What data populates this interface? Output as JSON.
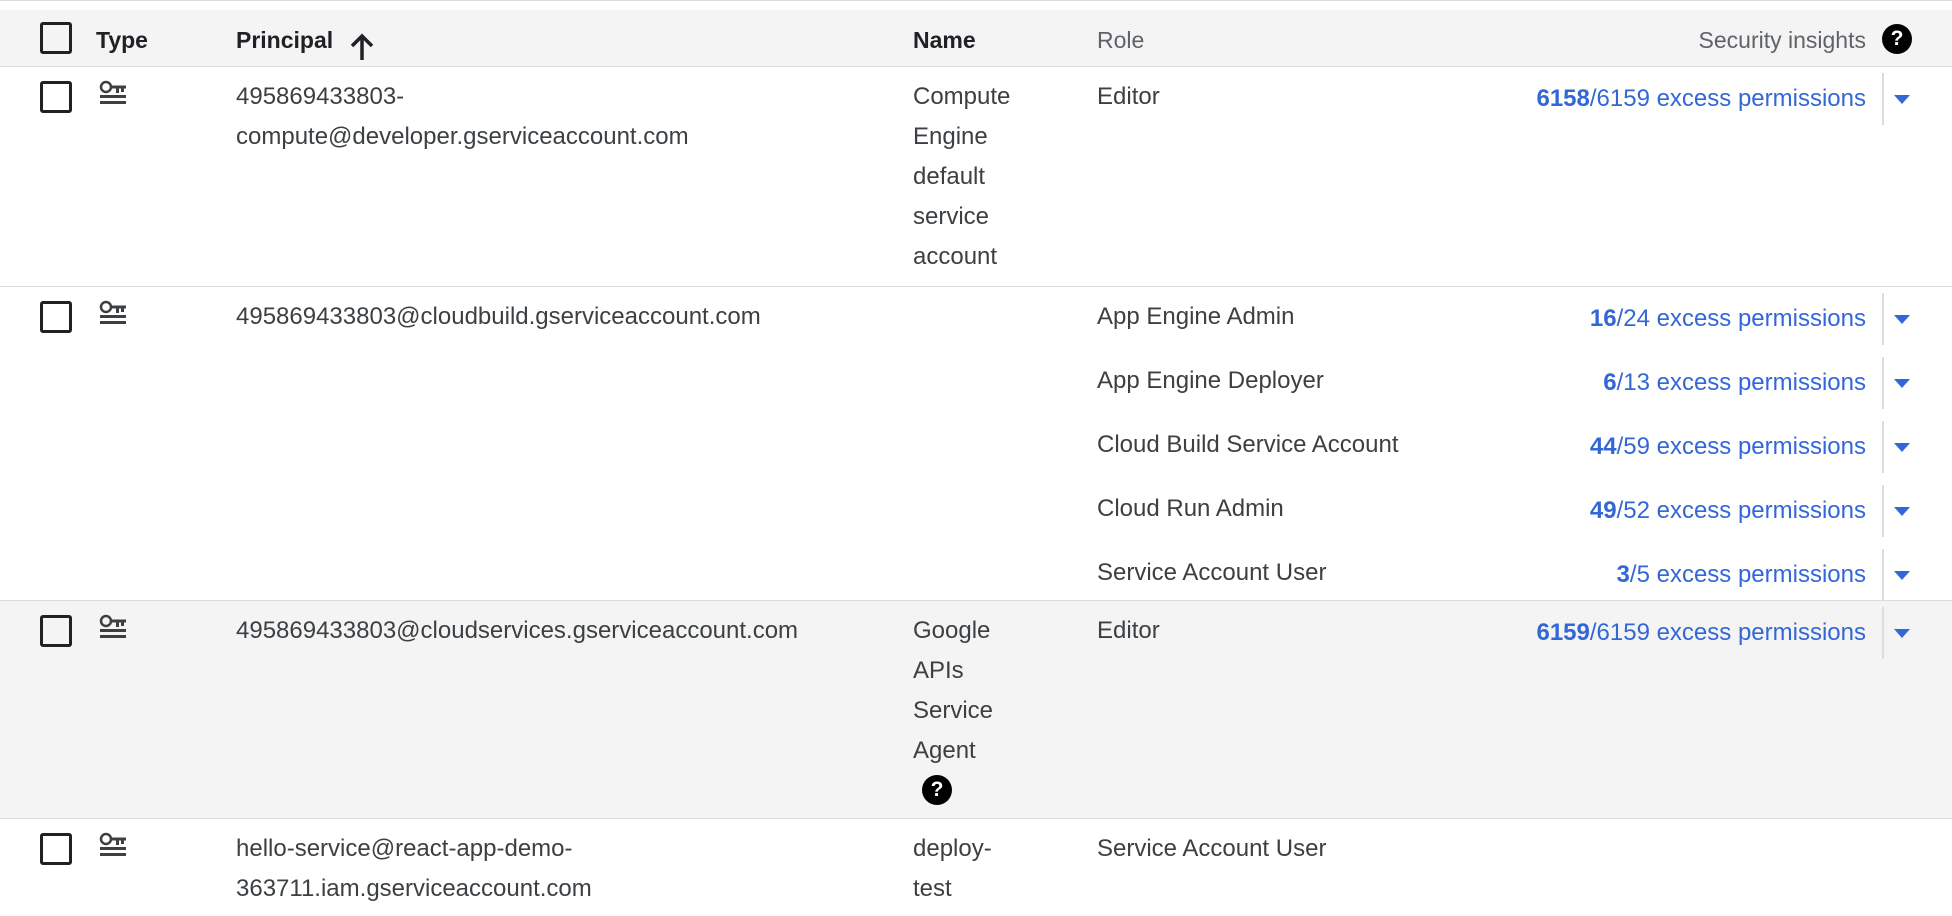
{
  "header": {
    "type": "Type",
    "principal": "Principal",
    "name": "Name",
    "role": "Role",
    "security_insights": "Security insights",
    "help_glyph": "?"
  },
  "rows": [
    {
      "principal": "495869433803-\ncompute@developer.gserviceaccount.com",
      "name": "Compute\nEngine\ndefault\nservice\naccount",
      "roles": [
        {
          "role": "Editor",
          "excess": "6158",
          "total": "/6159 excess permissions"
        }
      ]
    },
    {
      "principal": "495869433803@cloudbuild.gserviceaccount.com",
      "name": "",
      "roles": [
        {
          "role": "App Engine Admin",
          "excess": "16",
          "total": "/24 excess permissions"
        },
        {
          "role": "App Engine Deployer",
          "excess": "6",
          "total": "/13 excess permissions"
        },
        {
          "role": "Cloud Build Service Account",
          "excess": "44",
          "total": "/59 excess permissions"
        },
        {
          "role": "Cloud Run Admin",
          "excess": "49",
          "total": "/52 excess permissions"
        },
        {
          "role": "Service Account User",
          "excess": "3",
          "total": "/5 excess permissions"
        }
      ]
    },
    {
      "principal": "495869433803@cloudservices.gserviceaccount.com",
      "name": "Google\nAPIs\nService\nAgent",
      "name_help": "?",
      "roles": [
        {
          "role": "Editor",
          "excess": "6159",
          "total": "/6159 excess permissions"
        }
      ]
    },
    {
      "principal": "hello-service@react-app-demo-\n363711.iam.gserviceaccount.com",
      "name": "deploy-\ntest",
      "roles": [
        {
          "role": "Service Account User"
        }
      ]
    }
  ],
  "colors": {
    "link": "#3367d6",
    "header_bg": "#f4f4f4",
    "alt_row_bg": "#f4f4f4",
    "text": "#3c4043",
    "divider": "#dadce0"
  },
  "icons": {
    "type": "service-account-key-icon",
    "sort": "arrow-up-icon",
    "help": "help-circle-icon",
    "dropdown": "caret-down-icon"
  }
}
